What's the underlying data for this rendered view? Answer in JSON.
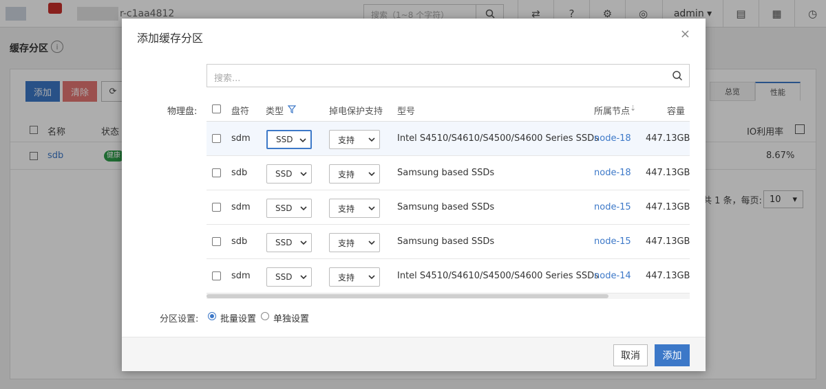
{
  "topbar": {
    "cluster_name": "r-c1aa4812",
    "search_placeholder": "搜索（1~8 个字符）",
    "user": "admin ▾"
  },
  "page": {
    "title": "缓存分区",
    "toolbar": {
      "add_label": "添加",
      "clear_label": "清除"
    },
    "table": {
      "col_name": "名称",
      "col_status": "状态",
      "col_io": "IO利用率",
      "row_name": "sdb",
      "row_status": "健康",
      "row_io": "8.67%"
    },
    "tabs": [
      "总览",
      "性能"
    ],
    "pager": {
      "text": "共 1 条，每页:",
      "size": "10"
    }
  },
  "modal": {
    "title": "添加缓存分区",
    "close": "×",
    "search_placeholder": "搜索...",
    "disk_label": "物理盘:",
    "columns": {
      "disk": "盘符",
      "type": "类型",
      "plp": "掉电保护支持",
      "model": "型号",
      "node": "所属节点",
      "capacity": "容量"
    },
    "rows": [
      {
        "disk": "sdm",
        "type": "SSD",
        "plp": "支持",
        "model": "Intel S4510/S4610/S4500/S4600 Series SSDs",
        "node": "node-18",
        "capacity": "447.13GB"
      },
      {
        "disk": "sdb",
        "type": "SSD",
        "plp": "支持",
        "model": "Samsung based SSDs",
        "node": "node-18",
        "capacity": "447.13GB"
      },
      {
        "disk": "sdm",
        "type": "SSD",
        "plp": "支持",
        "model": "Samsung based SSDs",
        "node": "node-15",
        "capacity": "447.13GB"
      },
      {
        "disk": "sdb",
        "type": "SSD",
        "plp": "支持",
        "model": "Samsung based SSDs",
        "node": "node-15",
        "capacity": "447.13GB"
      },
      {
        "disk": "sdm",
        "type": "SSD",
        "plp": "支持",
        "model": "Intel S4510/S4610/S4500/S4600 Series SSDs",
        "node": "node-14",
        "capacity": "447.13GB"
      }
    ],
    "partition_label": "分区设置:",
    "radio_batch": "批量设置",
    "radio_single": "单独设置",
    "cancel_label": "取消",
    "add_label": "添加"
  },
  "colors": {
    "accent": "#3c78c8",
    "danger": "#e57773",
    "success": "#2e9e4b"
  }
}
